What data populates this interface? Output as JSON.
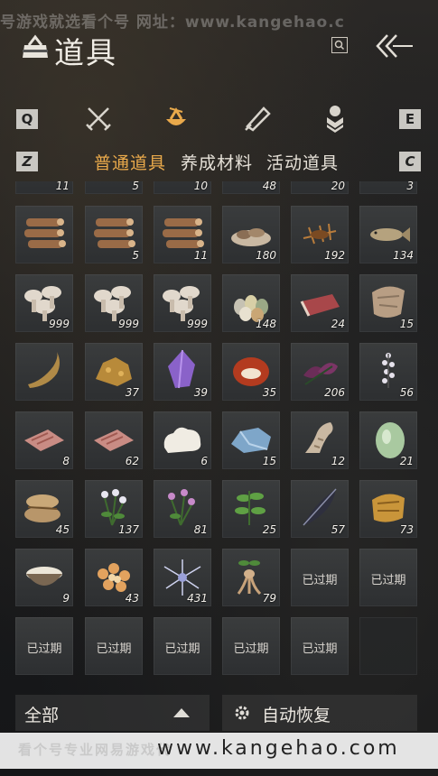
{
  "watermark_top": "号游戏就选看个号  网址：www.kangehao.c",
  "header": {
    "title": "道具"
  },
  "keys": {
    "prev_tab": "Q",
    "next_tab": "E",
    "prev_sub": "Z",
    "next_sub": "C"
  },
  "icons": {
    "bag": "pouch-icon",
    "search": "search-icon",
    "back": "double-chevron-left-icon",
    "tabs": [
      "crossed-swords-icon",
      "pouch-icon",
      "scroll-icon",
      "badge-icon"
    ]
  },
  "subtabs": [
    "普通道具",
    "养成材料",
    "活动道具"
  ],
  "partial_row": [
    "11",
    "5",
    "10",
    "48",
    "20",
    "3"
  ],
  "rows": [
    [
      {
        "icon": "logs",
        "count": ""
      },
      {
        "icon": "logs",
        "count": "5"
      },
      {
        "icon": "logs",
        "count": "11"
      },
      {
        "icon": "mushroom-plate",
        "count": "180"
      },
      {
        "icon": "insect",
        "count": "192"
      },
      {
        "icon": "fish",
        "count": "134"
      }
    ],
    [
      {
        "icon": "mushrooms",
        "count": "999"
      },
      {
        "icon": "mushrooms",
        "count": "999"
      },
      {
        "icon": "mushrooms",
        "count": "999"
      },
      {
        "icon": "eggs",
        "count": "148"
      },
      {
        "icon": "meat",
        "count": "24"
      },
      {
        "icon": "hide",
        "count": "15"
      }
    ],
    [
      {
        "icon": "root",
        "count": ""
      },
      {
        "icon": "ore",
        "count": "37"
      },
      {
        "icon": "crystal",
        "count": "39"
      },
      {
        "icon": "red-stone",
        "count": "35"
      },
      {
        "icon": "purple-leaf",
        "count": "206"
      },
      {
        "icon": "white-flower",
        "count": "56"
      }
    ],
    [
      {
        "icon": "raw-meat",
        "count": "8"
      },
      {
        "icon": "raw-meat",
        "count": "62"
      },
      {
        "icon": "cotton",
        "count": "6"
      },
      {
        "icon": "blue-ore",
        "count": "15"
      },
      {
        "icon": "bone",
        "count": "12"
      },
      {
        "icon": "melon",
        "count": "21"
      }
    ],
    [
      {
        "icon": "sacks",
        "count": "45"
      },
      {
        "icon": "white-herb",
        "count": "137"
      },
      {
        "icon": "pink-herb",
        "count": "81"
      },
      {
        "icon": "green-herb",
        "count": "25"
      },
      {
        "icon": "feather",
        "count": "57"
      },
      {
        "icon": "bark",
        "count": "73"
      }
    ],
    [
      {
        "icon": "bowl",
        "count": "9"
      },
      {
        "icon": "nuggets",
        "count": "43"
      },
      {
        "icon": "spider-lily",
        "count": "431"
      },
      {
        "icon": "ginseng",
        "count": "79"
      },
      {
        "expired": "已过期"
      },
      {
        "expired": "已过期"
      }
    ],
    [
      {
        "expired": "已过期"
      },
      {
        "expired": "已过期"
      },
      {
        "expired": "已过期"
      },
      {
        "expired": "已过期"
      },
      {
        "expired": "已过期"
      },
      {
        "expired": ""
      }
    ]
  ],
  "footer": {
    "filter_label": "全部",
    "auto_restore_label": "自动恢复"
  },
  "watermark_bottom": {
    "text": "看个号专业网易游戏代",
    "url": "www.kangehao.com"
  },
  "colors": {
    "accent": "#e9a94b",
    "cell": "#33353a"
  }
}
